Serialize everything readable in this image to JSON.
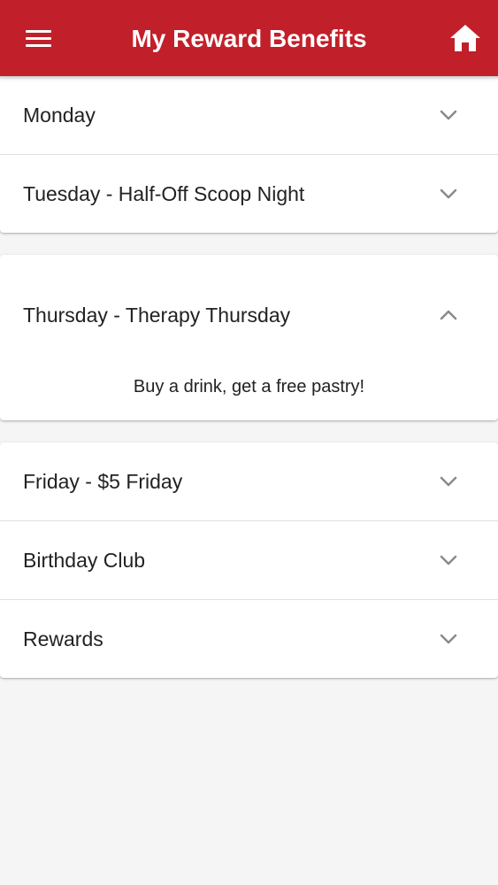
{
  "header": {
    "title": "My Reward Benefits",
    "background_color": "#c1202a",
    "menu_icon": "hamburger-menu-icon",
    "home_icon": "home-icon"
  },
  "groups": [
    {
      "items": [
        {
          "label": "Monday",
          "expanded": false,
          "icon": "chevron-down-icon"
        },
        {
          "label": "Tuesday - Half-Off Scoop Night",
          "expanded": false,
          "icon": "chevron-down-icon"
        }
      ]
    },
    {
      "items": [
        {
          "label": "Thursday - Therapy Thursday",
          "expanded": true,
          "icon": "chevron-up-icon",
          "content": "Buy a drink, get a free pastry!"
        }
      ]
    },
    {
      "items": [
        {
          "label": "Friday - $5 Friday",
          "expanded": false,
          "icon": "chevron-down-icon"
        },
        {
          "label": "Birthday Club",
          "expanded": false,
          "icon": "chevron-down-icon"
        },
        {
          "label": "Rewards",
          "expanded": false,
          "icon": "chevron-down-icon"
        }
      ]
    }
  ]
}
